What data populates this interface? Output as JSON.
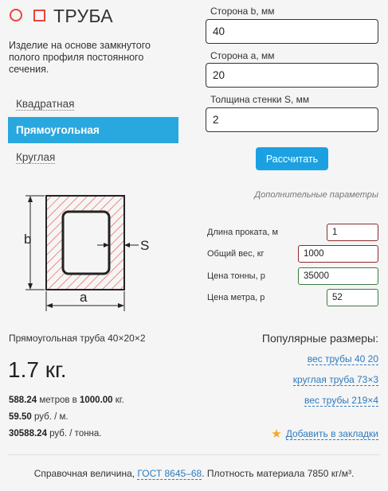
{
  "header": {
    "title": "ТРУБА",
    "description": "Изделие на основе замкнутого полого профиля постоянного сечения."
  },
  "tabs": [
    {
      "label": "Квадратная",
      "active": false
    },
    {
      "label": "Прямоугольная",
      "active": true
    },
    {
      "label": "Круглая",
      "active": false
    }
  ],
  "form": {
    "side_b": {
      "label": "Сторона b, мм",
      "value": "40"
    },
    "side_a": {
      "label": "Сторона a, мм",
      "value": "20"
    },
    "wall": {
      "label": "Толщина стенки S, мм",
      "value": "2"
    },
    "calc_button": "Рассчитать",
    "extra_params": "Дополнительные параметры"
  },
  "extra": {
    "length": {
      "label": "Длина проката, м",
      "value": "1"
    },
    "total_weight": {
      "label": "Общий вес, кг",
      "value": "1000"
    },
    "ton_price": {
      "label": "Цена тонны, р",
      "value": "35000"
    },
    "meter_price": {
      "label": "Цена метра, р",
      "value": "52"
    }
  },
  "diagram": {
    "label_b": "b",
    "label_a": "a",
    "label_s": "S"
  },
  "result": {
    "title": "Прямоугольная труба 40×20×2",
    "weight": "1.7 кг.",
    "meters_value": "588.24",
    "meters_mid": " метров в ",
    "meters_kg": "1000.00",
    "meters_end": " кг.",
    "rub_m_value": "59.50",
    "rub_m_unit": " руб. / м.",
    "rub_t_value": "30588.24",
    "rub_t_unit": " руб. / тонна."
  },
  "popular": {
    "title": "Популярные размеры:",
    "links": [
      "вес трубы 40 20",
      "круглая труба 73×3",
      "вес трубы 219×4"
    ],
    "bookmark": "Добавить в закладки"
  },
  "footer": {
    "before": "Справочная величина, ",
    "link": "ГОСТ 8645–68",
    "after": ". Плотность материала 7850 кг/м³."
  },
  "colors": {
    "accent": "#29a8e0",
    "button": "#1ba1e2",
    "hatch": "#e8453c",
    "link": "#2d7bbf"
  }
}
